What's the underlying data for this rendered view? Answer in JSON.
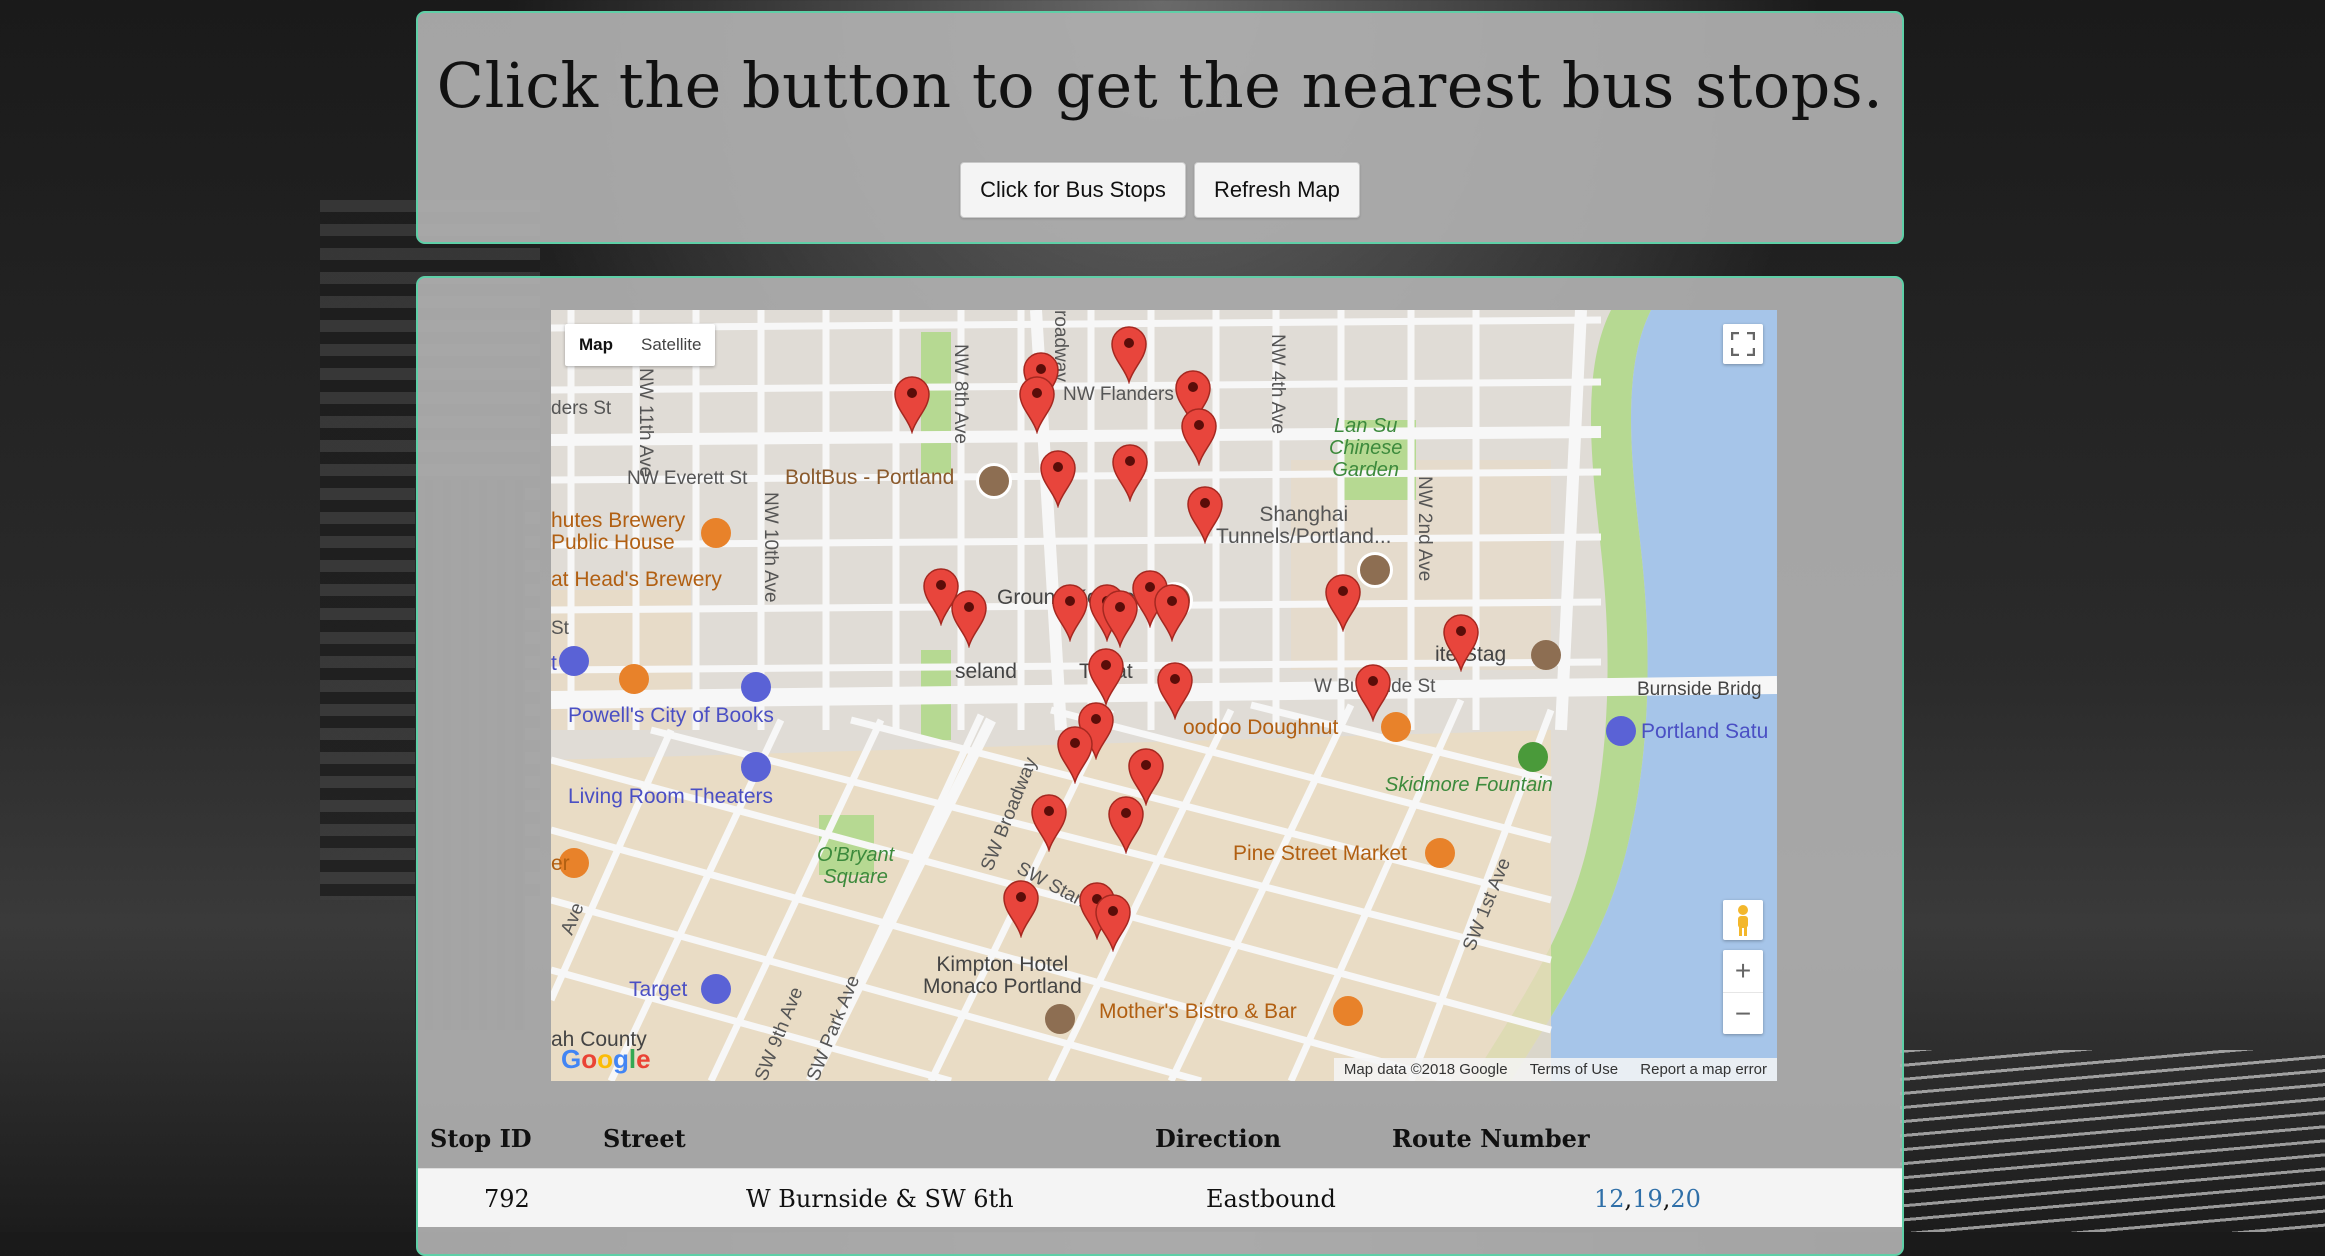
{
  "header": {
    "title": "Click the button to get the nearest bus stops.",
    "bus_button": "Click for Bus Stops",
    "refresh_button": "Refresh Map"
  },
  "map": {
    "type_map": "Map",
    "type_satellite": "Satellite",
    "zoom_in": "+",
    "zoom_out": "−",
    "attribution": "Map data ©2018 Google",
    "terms": "Terms of Use",
    "report": "Report a map error",
    "logo": "Google",
    "labels": {
      "flanders": "NW Flanders St",
      "everett": "NW Everett St",
      "eleventh": "NW 11th Ave",
      "tenth": "NW 10th Ave",
      "eighth": "NW 8th Ave",
      "broadway": "roadway",
      "fourth": "NW 4th Ave",
      "second": "NW 2nd Ave",
      "ders": "ders St",
      "st": "St",
      "burnside": "W Burnside St",
      "burnside_bridge": "Burnside Bridg",
      "sw_broadway": "SW Broadway",
      "sw_stark": "SW Stark St",
      "sw_first": "SW 1st Ave",
      "sw_ninth": "SW 9th Ave",
      "sw_park": "SW Park Ave",
      "ave": "Ave",
      "boltbus": "BoltBus - Portland",
      "deschutes": "hutes Brewery\nPublic House",
      "bridgeport": "at Head's Brewery",
      "ground_kontrol": "Ground Kontrol",
      "shanghai": "Shanghai\nTunnels/Portland...",
      "lan_su": "Lan Su\nChinese\nGarden",
      "white_stag": "ite Stag",
      "roseland": "seland",
      "theater": "Theat",
      "powells": "Powell's City of Books",
      "living_room": "Living Room Theaters",
      "obryant": "O'Bryant\nSquare",
      "voodoo": "oodoo Doughnut",
      "portland_sat": "Portland Satu",
      "skidmore": "Skidmore Fountain",
      "pine_street": "Pine Street Market",
      "kimpton": "Kimpton Hotel\nMonaco Portland",
      "mothers": "Mother's Bistro & Bar",
      "target": "Target",
      "county": "ah County",
      "er": "er",
      "t": "t"
    },
    "marker_count": 29
  },
  "table": {
    "headers": {
      "stop_id": "Stop ID",
      "street": "Street",
      "direction": "Direction",
      "route": "Route Number"
    },
    "rows": [
      {
        "stop_id": "792",
        "street": "W Burnside & SW 6th",
        "direction": "Eastbound",
        "routes": [
          "12",
          "19",
          "20"
        ]
      }
    ]
  },
  "colors": {
    "panel_border": "#5fcfa7",
    "marker": "#e8453c",
    "route_link": "#2f6fa8",
    "water": "#a3c7f0",
    "park": "#b6dd8d"
  }
}
